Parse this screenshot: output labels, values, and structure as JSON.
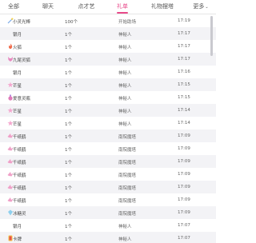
{
  "tabs": [
    {
      "label": "全部",
      "active": false
    },
    {
      "label": "聊天",
      "active": false
    },
    {
      "label": "点才艺",
      "active": false
    },
    {
      "label": "礼单",
      "active": true
    },
    {
      "label": "礼物摆塔",
      "active": false
    },
    {
      "label": "更多",
      "active": false
    }
  ],
  "accent_color": "#e84a8a",
  "gift_rows": [
    {
      "icon": "wand-icon",
      "name": "小灵光棒",
      "count": "100个",
      "target": "开始助场",
      "time": "17:19"
    },
    {
      "icon": "moon-icon",
      "name": "银月",
      "count": "1个",
      "target": "神秘人",
      "time": "17:17"
    },
    {
      "icon": "flame-icon",
      "name": "火狐",
      "count": "1个",
      "target": "神秘人",
      "time": "17:17"
    },
    {
      "icon": "fox-icon",
      "name": "九尾灵狐",
      "count": "1个",
      "target": "神秘人",
      "time": "17:17"
    },
    {
      "icon": "moon-icon",
      "name": "银月",
      "count": "1个",
      "target": "神秘人",
      "time": "17:16"
    },
    {
      "icon": "star-icon",
      "name": "芒星",
      "count": "1个",
      "target": "神秘人",
      "time": "17:15"
    },
    {
      "icon": "potion-icon",
      "name": "爱意灵瓶",
      "count": "1个",
      "target": "神秘人",
      "time": "17:15"
    },
    {
      "icon": "star-icon",
      "name": "芒星",
      "count": "1个",
      "target": "神秘人",
      "time": "17:14"
    },
    {
      "icon": "star-icon",
      "name": "芒星",
      "count": "1个",
      "target": "神秘人",
      "time": "17:14"
    },
    {
      "icon": "crane-icon",
      "name": "千纸鹤",
      "count": "1个",
      "target": "南院魔塔",
      "time": "17:09"
    },
    {
      "icon": "crane-icon",
      "name": "千纸鹤",
      "count": "1个",
      "target": "南院魔塔",
      "time": "17:09"
    },
    {
      "icon": "crane-icon",
      "name": "千纸鹤",
      "count": "1个",
      "target": "南院魔塔",
      "time": "17:09"
    },
    {
      "icon": "crane-icon",
      "name": "千纸鹤",
      "count": "1个",
      "target": "南院魔塔",
      "time": "17:09"
    },
    {
      "icon": "crane-icon",
      "name": "千纸鹤",
      "count": "1个",
      "target": "南院魔塔",
      "time": "17:09"
    },
    {
      "icon": "crane-icon",
      "name": "千纸鹤",
      "count": "1个",
      "target": "南院魔塔",
      "time": "17:09"
    },
    {
      "icon": "ice-icon",
      "name": "冰糖灵",
      "count": "1个",
      "target": "南院魔塔",
      "time": "17:09"
    },
    {
      "icon": "moon-icon",
      "name": "银月",
      "count": "1个",
      "target": "神秘人",
      "time": "17:07"
    },
    {
      "icon": "card-icon",
      "name": "卡牌",
      "count": "1个",
      "target": "神秘人",
      "time": "17:07"
    }
  ]
}
